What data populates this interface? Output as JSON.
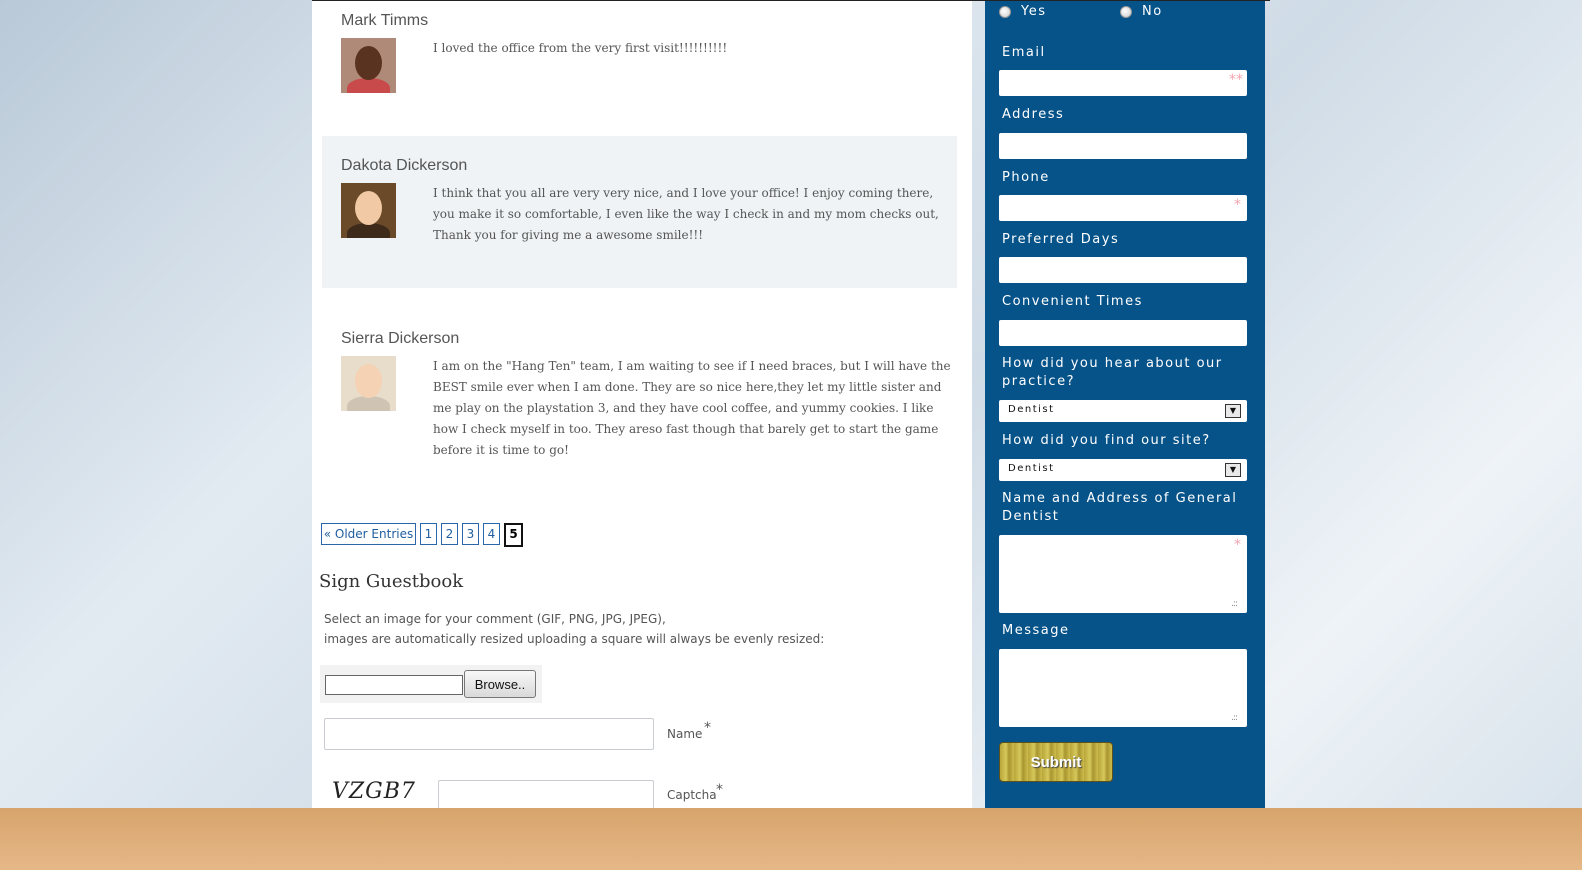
{
  "entries": [
    {
      "name": "Mark Timms",
      "text": "I loved the office from the very first visit!!!!!!!!!!"
    },
    {
      "name": "Dakota Dickerson",
      "text": "I think that you all are very very nice, and I love your office! I enjoy coming there, you make it so comfortable, I even like the way I check in and my mom checks out, Thank you for giving me a awesome smile!!!"
    },
    {
      "name": "Sierra Dickerson",
      "text": "I am on the \"Hang Ten\" team, I am waiting to see if I need braces, but I will have the BEST smile ever when I am done. They are so nice here,they let my little sister and me play on the playstation 3, and they have cool coffee, and yummy cookies. I like how I check myself in too. They areso fast though that barely get to start the game before it is time to go!"
    }
  ],
  "pagination": {
    "older": "« Older Entries",
    "pages": [
      "1",
      "2",
      "3",
      "4"
    ],
    "current": "5"
  },
  "guestbook": {
    "title": "Sign Guestbook",
    "upload_note_line1": "Select an image for your comment (GIF, PNG, JPG, JPEG),",
    "upload_note_line2": "images are automatically resized uploading a square will always be evenly resized:",
    "browse_label": "Browse..",
    "name_label": "Name",
    "required_mark": "*",
    "captcha_code": "VZGB7",
    "captcha_label": "Captcha"
  },
  "form": {
    "yes_label": "Yes",
    "no_label": "No",
    "email_label": "Email",
    "email_mark": "**",
    "address_label": "Address",
    "phone_label": "Phone",
    "phone_mark": "*",
    "preferred_days_label": "Preferred Days",
    "convenient_times_label": "Convenient Times",
    "hear_label": "How did you hear about our practice?",
    "hear_value": "Dentist",
    "find_label": "How did you find our site?",
    "find_value": "Dentist",
    "general_dentist_label": "Name and Address of General Dentist",
    "general_dentist_mark": "*",
    "message_label": "Message",
    "submit_label": "Submit"
  },
  "colors": {
    "sidebar_bg": "#06538a",
    "link": "#1f5ea0",
    "required_star": "#f3a5b0"
  }
}
